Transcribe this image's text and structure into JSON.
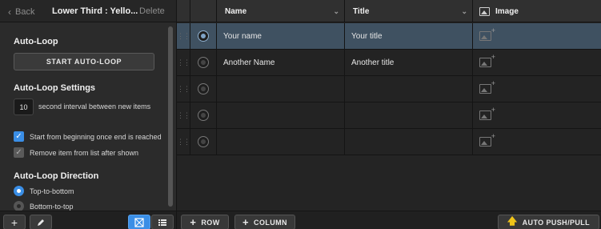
{
  "header": {
    "back_label": "Back",
    "title": "Lower Third : Yello...",
    "delete_label": "Delete"
  },
  "autoloop": {
    "section_title": "Auto-Loop",
    "start_button": "START AUTO-LOOP",
    "settings_title": "Auto-Loop Settings",
    "interval_value": "10",
    "interval_label": "second interval between new items",
    "start_from_beginning": {
      "label": "Start from beginning once end is reached",
      "checked": true
    },
    "remove_after_shown": {
      "label": "Remove item from list after shown",
      "checked": false
    },
    "direction_title": "Auto-Loop Direction",
    "directions": [
      {
        "label": "Top-to-bottom",
        "selected": true
      },
      {
        "label": "Bottom-to-top",
        "selected": false
      }
    ]
  },
  "left_footer": {
    "add_icon": "plus-icon",
    "edit_icon": "pencil-icon",
    "grid_view_icon": "grid-view-icon",
    "list_view_icon": "list-view-icon"
  },
  "grid": {
    "columns": [
      {
        "label": "Name",
        "icon": "dropdown-caret"
      },
      {
        "label": "Title",
        "icon": "dropdown-caret"
      },
      {
        "label": "Image",
        "icon": "image-icon"
      }
    ],
    "rows": [
      {
        "name": "Your name",
        "title": "Your title",
        "selected": true
      },
      {
        "name": "Another Name",
        "title": "Another title",
        "selected": false
      },
      {
        "name": "",
        "title": "",
        "selected": false
      },
      {
        "name": "",
        "title": "",
        "selected": false
      },
      {
        "name": "",
        "title": "",
        "selected": false
      }
    ]
  },
  "grid_footer": {
    "add_row": "ROW",
    "add_column": "COLUMN",
    "auto_push_pull": "AUTO PUSH/PULL"
  },
  "colors": {
    "accent": "#3a8ee6",
    "selected_row": "#3f5161",
    "push_arrow": "#f0c419"
  }
}
